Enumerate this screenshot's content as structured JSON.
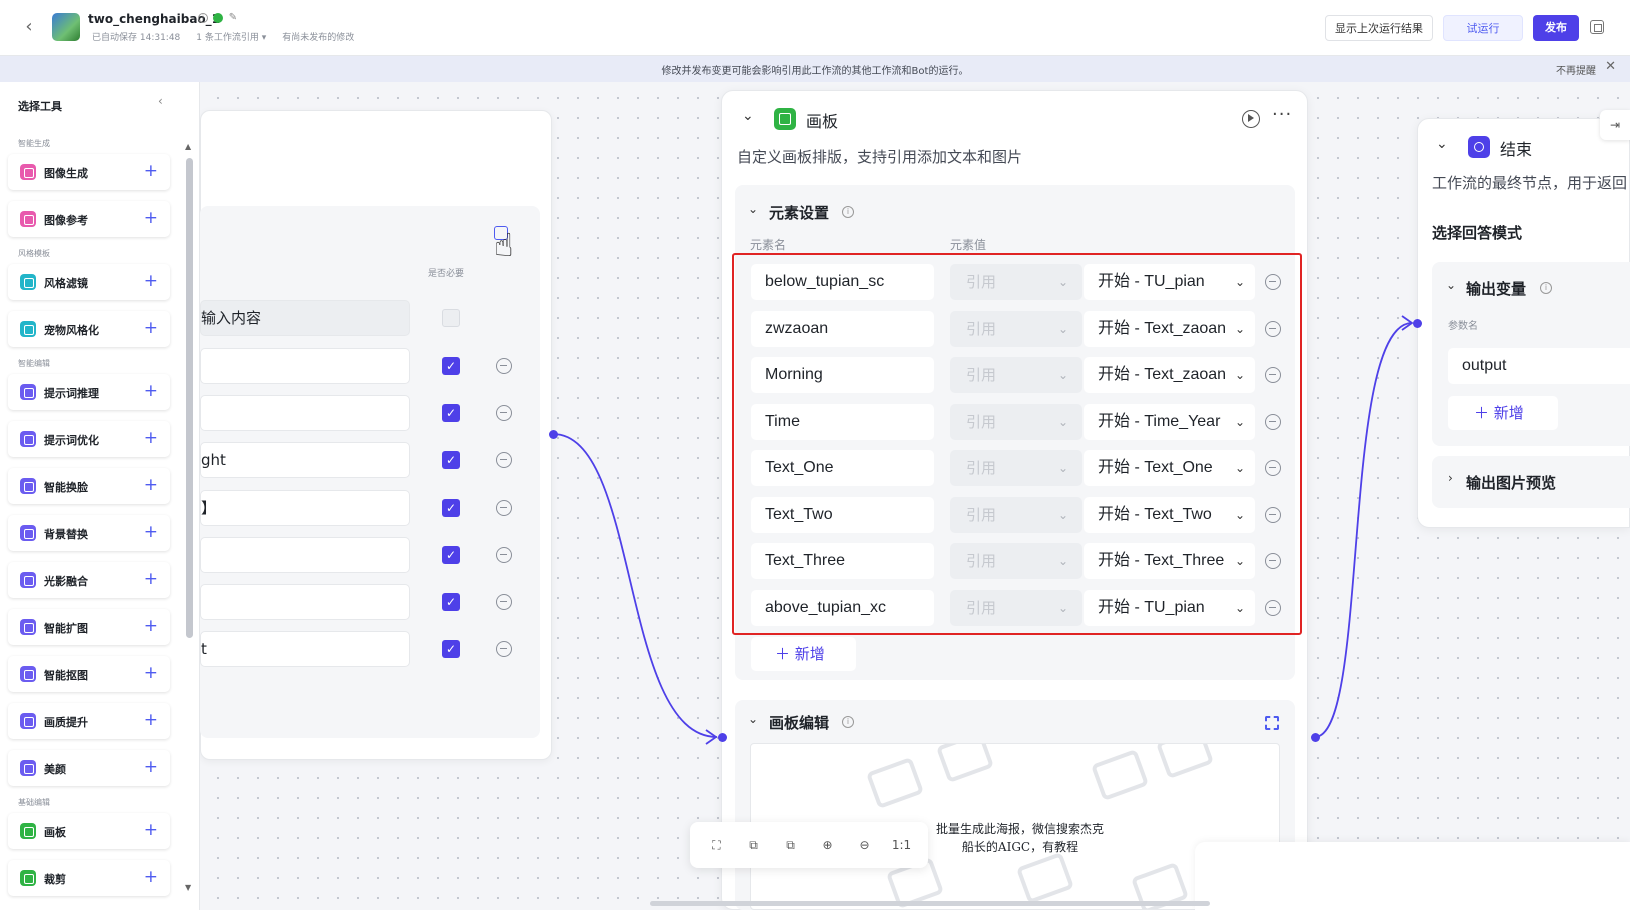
{
  "header": {
    "title": "two_chenghaibao_1",
    "autosave": "已自动保存 14:31:48",
    "references": "1 条工作流引用 ▾",
    "unpublished": "有尚未发布的修改",
    "btn_last_run": "显示上次运行结果",
    "btn_trial": "试运行",
    "btn_publish": "发布"
  },
  "notice": {
    "text": "修改并发布变更可能会影响引用此工作流的其他工作流和Bot的运行。",
    "dismiss": "不再提醒"
  },
  "tools": {
    "heading": "选择工具",
    "categories": [
      {
        "label": "智能生成",
        "items": [
          {
            "label": "图像生成",
            "color": "#e85aad"
          },
          {
            "label": "图像参考",
            "color": "#e85aad"
          }
        ]
      },
      {
        "label": "风格模板",
        "items": [
          {
            "label": "风格滤镜",
            "color": "#22b5c9"
          },
          {
            "label": "宠物风格化",
            "color": "#22b5c9"
          }
        ]
      },
      {
        "label": "智能编辑",
        "items": [
          {
            "label": "提示词推理",
            "color": "#6b5cf0"
          },
          {
            "label": "提示词优化",
            "color": "#6b5cf0"
          },
          {
            "label": "智能换脸",
            "color": "#6b5cf0"
          },
          {
            "label": "背景替换",
            "color": "#6b5cf0"
          },
          {
            "label": "光影融合",
            "color": "#6b5cf0"
          },
          {
            "label": "智能扩图",
            "color": "#6b5cf0"
          },
          {
            "label": "智能抠图",
            "color": "#6b5cf0"
          },
          {
            "label": "画质提升",
            "color": "#6b5cf0"
          },
          {
            "label": "美颜",
            "color": "#6b5cf0"
          }
        ]
      },
      {
        "label": "基础编辑",
        "items": [
          {
            "label": "画板",
            "color": "#2fb344"
          },
          {
            "label": "裁剪",
            "color": "#2fb344"
          }
        ]
      }
    ]
  },
  "start_node": {
    "required_label": "是否必要",
    "rows": [
      "输入内容",
      "",
      "",
      "ght",
      "】",
      "",
      "",
      "t"
    ]
  },
  "board_node": {
    "title": "画板",
    "description": "自定义画板排版，支持引用添加文本和图片",
    "elements_section": "元素设置",
    "col_name": "元素名",
    "col_value": "元素值",
    "elements": [
      {
        "name": "below_tupian_sc",
        "type": "引用",
        "value": "开始 - TU_pian"
      },
      {
        "name": "zwzaoan",
        "type": "引用",
        "value": "开始 - Text_zaoan"
      },
      {
        "name": "Morning",
        "type": "引用",
        "value": "开始 - Text_zaoan"
      },
      {
        "name": "Time",
        "type": "引用",
        "value": "开始 - Time_Year"
      },
      {
        "name": "Text_One",
        "type": "引用",
        "value": "开始 - Text_One"
      },
      {
        "name": "Text_Two",
        "type": "引用",
        "value": "开始 - Text_Two"
      },
      {
        "name": "Text_Three",
        "type": "引用",
        "value": "开始 - Text_Three"
      },
      {
        "name": "above_tupian_xc",
        "type": "引用",
        "value": "开始 - TU_pian"
      }
    ],
    "add_label": "新增",
    "edit_section": "画板编辑",
    "preview_text_line1": "批量生成此海报，微信搜索杰克",
    "preview_text_line2": "船长的AIGC，有教程"
  },
  "zoom_toolbar": [
    "⛶",
    "⧉",
    "⧉",
    "⊕",
    "⊖",
    "1:1"
  ],
  "end_node": {
    "title": "结束",
    "description": "工作流的最终节点，用于返回",
    "mode_label": "选择回答模式",
    "output_section": "输出变量",
    "param_label": "参数名",
    "param_value": "output",
    "add_label": "新增",
    "preview_section": "输出图片预览"
  }
}
